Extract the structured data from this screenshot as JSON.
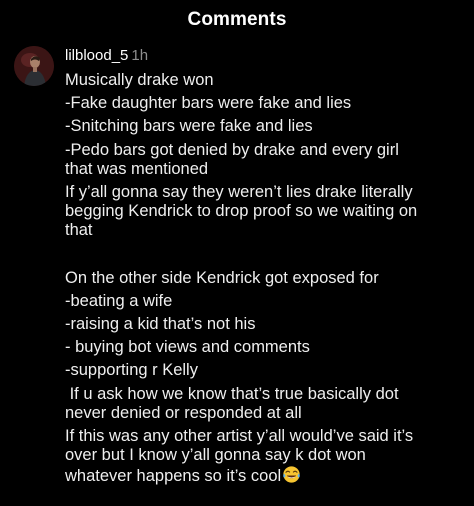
{
  "header": {
    "title": "Comments"
  },
  "comment": {
    "username": "lilblood_5",
    "timestamp": "1h",
    "avatar_icon": "user-avatar-photo",
    "lines": [
      "Musically drake won",
      "-Fake daughter bars were fake and lies",
      "-Snitching bars were fake and lies",
      "-Pedo bars got denied by drake and every girl",
      "that was mentioned",
      "If y’all gonna say they weren’t lies drake literally",
      "begging Kendrick to drop proof so we waiting on",
      "that",
      "On the other side Kendrick got exposed for",
      "-beating a wife",
      "-raising a kid that’s not his",
      "- buying bot views and comments",
      "-supporting r Kelly",
      " If u ask how we know that’s true basically dot",
      "never denied or responded at all",
      "If this was any other artist y’all would’ve said it’s",
      "over but I know y’all gonna say k dot won",
      "whatever happens so it’s cool"
    ],
    "emoji_icon": "tears-of-joy-emoji-icon"
  },
  "colors": {
    "background": "#000000",
    "text": "#efefef",
    "timestamp": "#8e8e8e"
  }
}
